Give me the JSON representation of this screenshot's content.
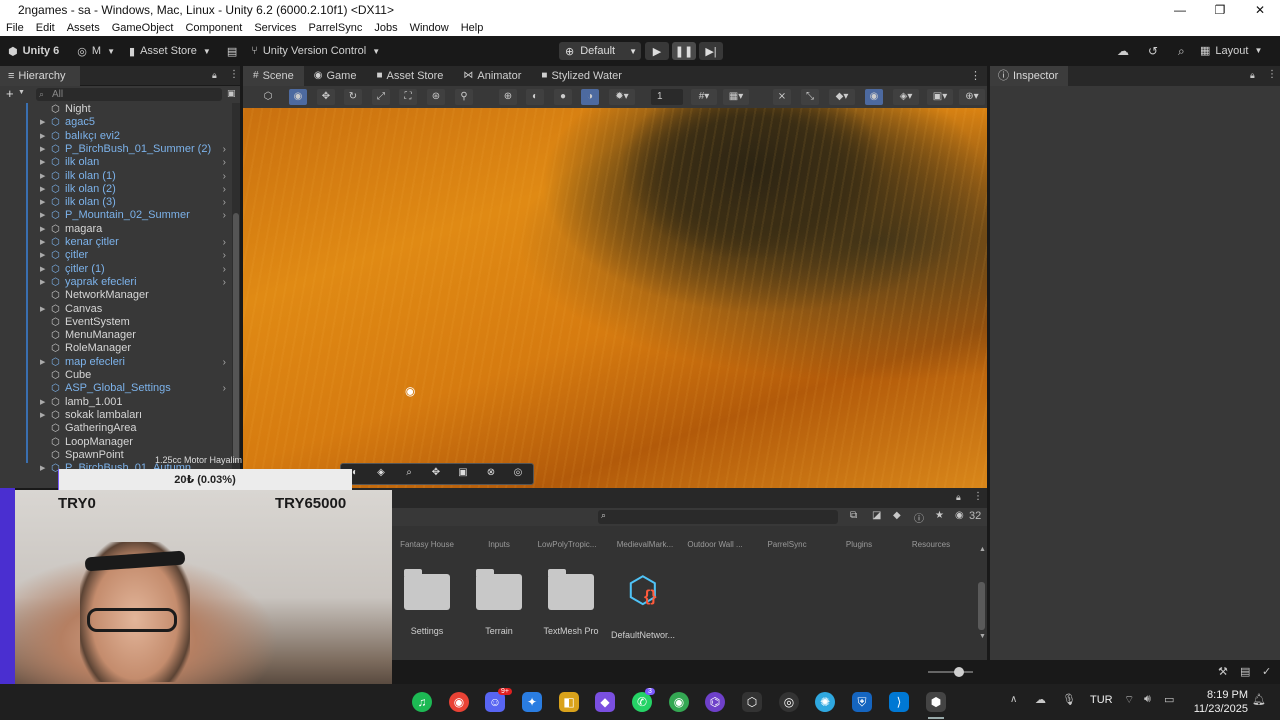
{
  "window": {
    "title": "2ngames - sa - Windows, Mac, Linux - Unity 6.2 (6000.2.10f1) <DX11>",
    "min": "—",
    "max": "❐",
    "close": "✕"
  },
  "menu": [
    "File",
    "Edit",
    "Assets",
    "GameObject",
    "Component",
    "Services",
    "ParrelSync",
    "Jobs",
    "Window",
    "Help"
  ],
  "toolbar": {
    "unity_label": "Unity 6",
    "account_label": "M",
    "asset_store_label": "Asset Store",
    "version_control_label": "Unity Version Control",
    "layout_mode": "Default",
    "layout_label": "Layout"
  },
  "hierarchy": {
    "tab_label": "Hierarchy",
    "search_placeholder": "All",
    "items": [
      {
        "name": "Night",
        "style": "white",
        "arrow": false,
        "more": false
      },
      {
        "name": "agac5",
        "style": "blue",
        "arrow": true,
        "more": false
      },
      {
        "name": "balıkçı evi2",
        "style": "blue",
        "arrow": true,
        "more": false
      },
      {
        "name": "P_BirchBush_01_Summer (2)",
        "style": "blue",
        "arrow": true,
        "more": true
      },
      {
        "name": "ilk olan",
        "style": "blue",
        "arrow": true,
        "more": true
      },
      {
        "name": "ilk olan (1)",
        "style": "blue",
        "arrow": true,
        "more": true
      },
      {
        "name": "ilk olan (2)",
        "style": "blue",
        "arrow": true,
        "more": true
      },
      {
        "name": "ilk olan (3)",
        "style": "blue",
        "arrow": true,
        "more": true
      },
      {
        "name": "P_Mountain_02_Summer",
        "style": "blue",
        "arrow": true,
        "more": true
      },
      {
        "name": "magara",
        "style": "white",
        "arrow": true,
        "more": false
      },
      {
        "name": "kenar çitler",
        "style": "blue",
        "arrow": true,
        "more": true
      },
      {
        "name": "çitler",
        "style": "blue",
        "arrow": true,
        "more": true
      },
      {
        "name": "çitler (1)",
        "style": "blue",
        "arrow": true,
        "more": true
      },
      {
        "name": "yaprak efecleri",
        "style": "blue",
        "arrow": true,
        "more": true
      },
      {
        "name": "NetworkManager",
        "style": "white",
        "arrow": false,
        "more": false
      },
      {
        "name": "Canvas",
        "style": "white",
        "arrow": true,
        "more": false
      },
      {
        "name": "EventSystem",
        "style": "white",
        "arrow": false,
        "more": false
      },
      {
        "name": "MenuManager",
        "style": "white",
        "arrow": false,
        "more": false
      },
      {
        "name": "RoleManager",
        "style": "white",
        "arrow": false,
        "more": false
      },
      {
        "name": "map efecleri",
        "style": "blue",
        "arrow": true,
        "more": true
      },
      {
        "name": "Cube",
        "style": "white",
        "arrow": false,
        "more": false
      },
      {
        "name": "ASP_Global_Settings",
        "style": "blue",
        "arrow": false,
        "more": true
      },
      {
        "name": "lamb_1.001",
        "style": "white",
        "arrow": true,
        "more": false
      },
      {
        "name": "sokak lambaları",
        "style": "white",
        "arrow": true,
        "more": false
      },
      {
        "name": "GatheringArea",
        "style": "white",
        "arrow": false,
        "more": false
      },
      {
        "name": "LoopManager",
        "style": "white",
        "arrow": false,
        "more": false
      },
      {
        "name": "SpawnPoint",
        "style": "white",
        "arrow": false,
        "more": false
      },
      {
        "name": "P_BirchBush_01_Autumn",
        "style": "blue",
        "arrow": true,
        "more": false
      }
    ]
  },
  "scene": {
    "tabs": [
      {
        "label": "Scene",
        "icon": "#",
        "active": true
      },
      {
        "label": "Game",
        "icon": "◉",
        "active": false
      },
      {
        "label": "Asset Store",
        "icon": "■",
        "active": false
      },
      {
        "label": "Animator",
        "icon": "⋈",
        "active": false
      },
      {
        "label": "Stylized Water",
        "icon": "■",
        "active": false
      }
    ],
    "grid_value": "1"
  },
  "inspector": {
    "tab_label": "Inspector"
  },
  "project": {
    "result_count": "32",
    "top_folders": [
      "Fantasy House",
      "Inputs",
      "LowPolyTropic...",
      "MedievalMark...",
      "Outdoor Wall ...",
      "ParrelSync",
      "Plugins",
      "Resources"
    ],
    "items": [
      {
        "label": "Settings",
        "kind": "folder"
      },
      {
        "label": "Terrain",
        "kind": "folder"
      },
      {
        "label": "TextMesh Pro",
        "kind": "folder"
      },
      {
        "label": "DefaultNetwor...",
        "kind": "prefab"
      }
    ]
  },
  "stream_overlay": {
    "donation_caption": "1.25cc Motor Hayalim",
    "donation_progress": "20₺ (0.03%)",
    "goal_min": "TRY0",
    "goal_max": "TRY65000",
    "progress_fraction": 0.0003
  },
  "taskbar": {
    "language": "TUR",
    "time": "8:19 PM",
    "date": "11/23/2025",
    "whatsapp_badge": "3",
    "discord_badge": "9+"
  },
  "colors": {
    "editor_bg": "#383838",
    "panel_header": "#282828",
    "prefab_blue": "#7cb2ea",
    "stream_frame": "#4a2fd0"
  }
}
